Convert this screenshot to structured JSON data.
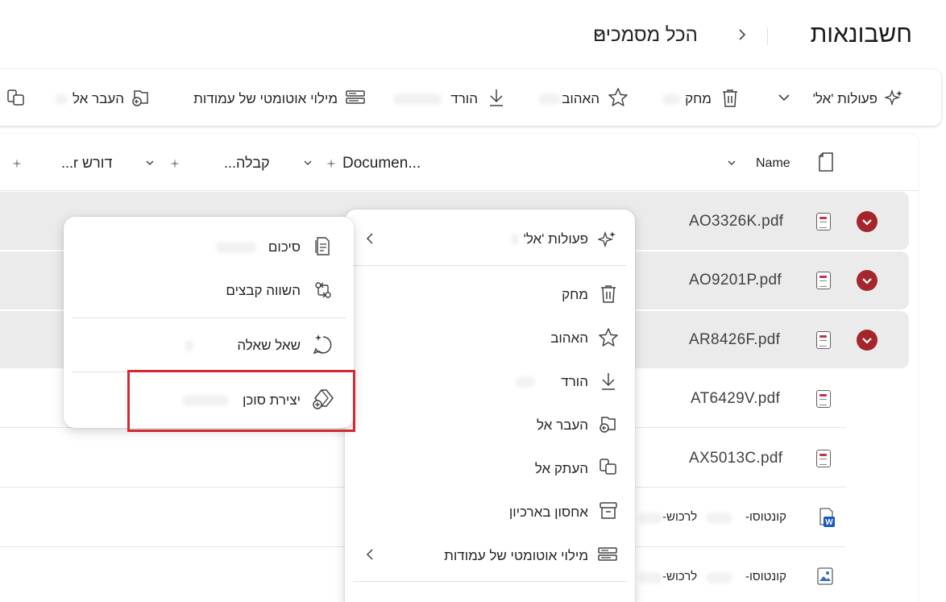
{
  "header": {
    "title": "חשבונאות",
    "breadcrumb_view": "הכל מסמכים"
  },
  "toolbar": {
    "ai_actions": "פעולות 'אל'",
    "delete": "מחק",
    "favorite": "האהוב",
    "download": "הורד",
    "autofill": "מילוי אוטומטי של עמודות",
    "move_to": "העבר אל"
  },
  "columns": {
    "name": "Name",
    "document": "Documen...",
    "receipt": "קבלה...",
    "requires": "דורש r..."
  },
  "rows": [
    {
      "name": "AO3326K.pdf",
      "selected": true,
      "type": "pdf"
    },
    {
      "name": "AO9201P.pdf",
      "selected": true,
      "type": "pdf"
    },
    {
      "name": "AR8426F.pdf",
      "selected": true,
      "type": "pdf"
    },
    {
      "name": "AT6429V.pdf",
      "selected": false,
      "type": "pdf"
    },
    {
      "name": "AX5013C.pdf",
      "selected": false,
      "type": "pdf"
    },
    {
      "name": "קונטוסו-",
      "selected": false,
      "type": "word",
      "extra": "לרכוש-"
    },
    {
      "name": "קונטוסו-",
      "selected": false,
      "type": "image",
      "extra": "לרכוש-"
    }
  ],
  "context_menu": {
    "ai_actions": "פעולות 'אל'",
    "delete": "מחק",
    "favorite": "האהוב",
    "download": "הורד",
    "move_to": "העבר אל",
    "copy_to": "העתק אל",
    "archive": "אחסון בארכיון",
    "autofill": "מילוי אוטומטי של עמודות"
  },
  "sub_menu": {
    "summary": "סיכום",
    "compare": "השווה קבצים",
    "ask": "שאל שאלה",
    "create_agent": "יצירת סוכן"
  },
  "colors": {
    "accent_red": "#a4262c",
    "highlight_red": "#d32a2f",
    "selected_row": "#ebebeb"
  }
}
